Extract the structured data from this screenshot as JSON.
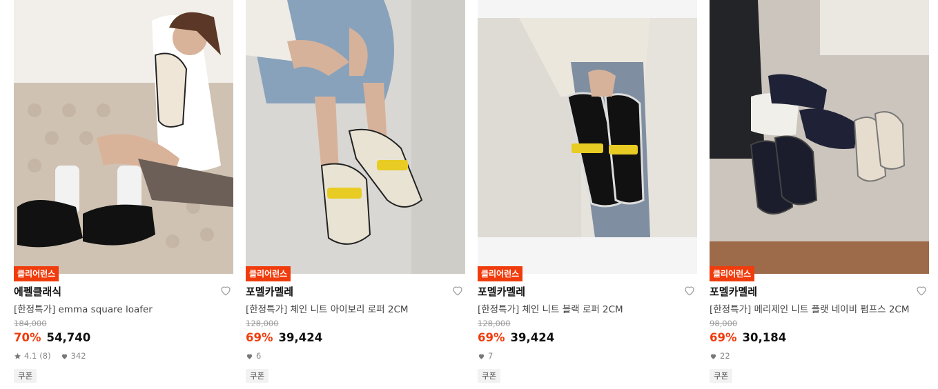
{
  "products": [
    {
      "badge": "클리어런스",
      "brand": "에펠클래식",
      "title": "[한정특가] emma square loafer",
      "original_price": "184,000",
      "discount": "70%",
      "price": "54,740",
      "rating": "4.1",
      "review_count": "(8)",
      "likes": "342",
      "coupon": "쿠폰"
    },
    {
      "badge": "클리어런스",
      "brand": "포멜카멜레",
      "title": "[한정특가] 체인 니트 아이보리 로퍼 2CM",
      "original_price": "128,000",
      "discount": "69%",
      "price": "39,424",
      "likes": "6",
      "coupon": "쿠폰"
    },
    {
      "badge": "클리어런스",
      "brand": "포멜카멜레",
      "title": "[한정특가] 체인 니트 블랙 로퍼 2CM",
      "original_price": "128,000",
      "discount": "69%",
      "price": "39,424",
      "likes": "7",
      "coupon": "쿠폰"
    },
    {
      "badge": "클리어런스",
      "brand": "포멜카멜레",
      "title": "[한정특가] 메리제인 니트 플랫 네이비 펌프스 2CM",
      "original_price": "98,000",
      "discount": "69%",
      "price": "30,184",
      "likes": "22",
      "coupon": "쿠폰"
    }
  ],
  "colors": {
    "accent": "#f03c0c",
    "text": "#111111",
    "muted": "#888888"
  }
}
